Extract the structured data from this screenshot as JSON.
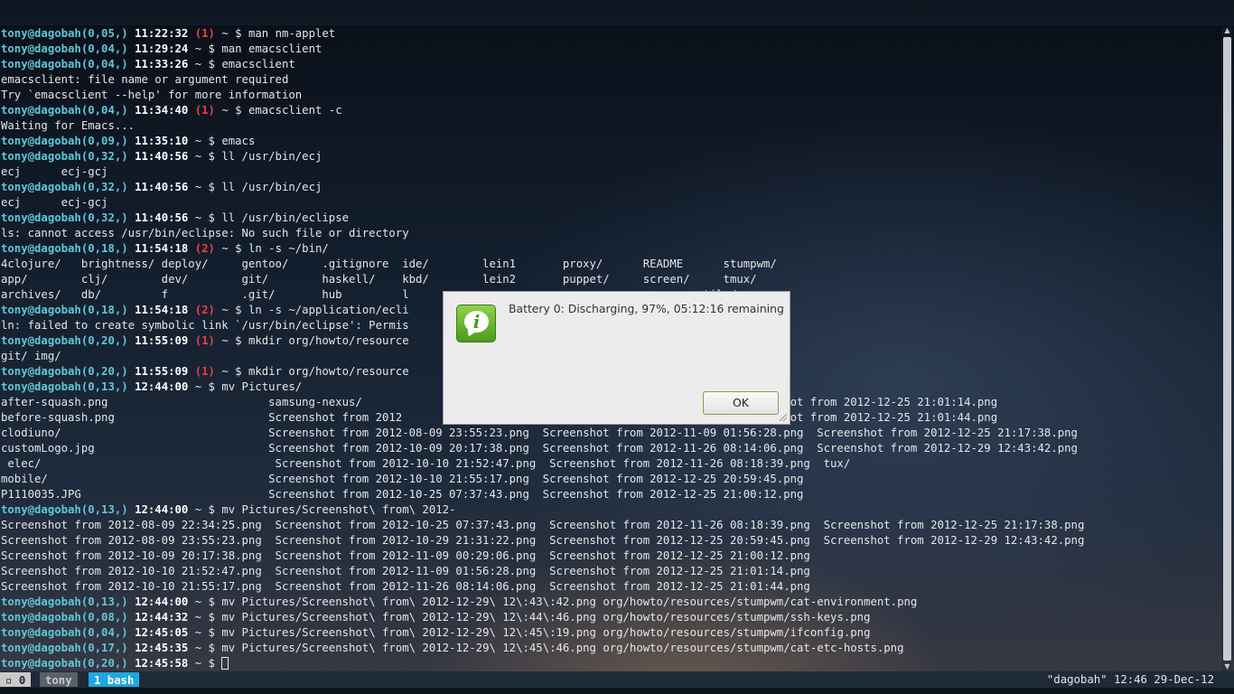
{
  "terminal": {
    "lines": [
      {
        "user": "tony@dagobah(0,05,)",
        "time": "11:22:32",
        "err": "(1)",
        "cmd": "~ $ man nm-applet"
      },
      {
        "user": "tony@dagobah(0,04,)",
        "time": "11:29:24",
        "cmd": "~ $ man emacsclient"
      },
      {
        "user": "tony@dagobah(0,04,)",
        "time": "11:33:26",
        "cmd": "~ $ emacsclient"
      },
      {
        "text": "emacsclient: file name or argument required"
      },
      {
        "text": "Try `emacsclient --help' for more information"
      },
      {
        "user": "tony@dagobah(0,04,)",
        "time": "11:34:40",
        "err": "(1)",
        "cmd": "~ $ emacsclient -c"
      },
      {
        "text": "Waiting for Emacs..."
      },
      {
        "user": "tony@dagobah(0,09,)",
        "time": "11:35:10",
        "cmd": "~ $ emacs"
      },
      {
        "user": "tony@dagobah(0,32,)",
        "time": "11:40:56",
        "cmd": "~ $ ll /usr/bin/ecj"
      },
      {
        "text": "ecj      ecj-gcj"
      },
      {
        "user": "tony@dagobah(0,32,)",
        "time": "11:40:56",
        "cmd": "~ $ ll /usr/bin/ecj"
      },
      {
        "text": "ecj      ecj-gcj"
      },
      {
        "user": "tony@dagobah(0,32,)",
        "time": "11:40:56",
        "cmd": "~ $ ll /usr/bin/eclipse"
      },
      {
        "text": "ls: cannot access /usr/bin/eclipse: No such file or directory"
      },
      {
        "user": "tony@dagobah(0,18,)",
        "time": "11:54:18",
        "err": "(2)",
        "cmd": "~ $ ln -s ~/bin/"
      },
      {
        "text": "4clojure/   brightness/ deploy/     gentoo/     .gitignore  ide/        lein1       proxy/      README      stumpwm/"
      },
      {
        "text": "app/        clj/        dev/        git/        haskell/    kbd/        lein2       puppet/     screen/     tmux/"
      },
      {
        "text": "archives/   db/         f           .git/       hub         l                                            tils/"
      },
      {
        "user": "tony@dagobah(0,18,)",
        "time": "11:54:18",
        "err": "(2)",
        "cmd": "~ $ ln -s ~/application/ecli"
      },
      {
        "text": "ln: failed to create symbolic link `/usr/bin/eclipse': Permis"
      },
      {
        "user": "tony@dagobah(0,20,)",
        "time": "11:55:09",
        "err": "(1)",
        "cmd": "~ $ mkdir org/howto/resource"
      },
      {
        "text": "git/ img/"
      },
      {
        "user": "tony@dagobah(0,20,)",
        "time": "11:55:09",
        "err": "(1)",
        "cmd": "~ $ mkdir org/howto/resource"
      },
      {
        "user": "tony@dagobah(0,13,)",
        "time": "12:44:00",
        "cmd": "~ $ mv Pictures/"
      },
      {
        "text": "after-squash.png                        samsung-nexus/                                          21:31:22.png  Screenshot from 2012-12-25 21:01:14.png"
      },
      {
        "text": "before-squash.png                       Screenshot from 2012                                    00:29:06.png  Screenshot from 2012-12-25 21:01:44.png"
      },
      {
        "text": "clodiuno/                               Screenshot from 2012-08-09 23:55:23.png  Screenshot from 2012-11-09 01:56:28.png  Screenshot from 2012-12-25 21:17:38.png"
      },
      {
        "text": "customLogo.jpg                          Screenshot from 2012-10-09 20:17:38.png  Screenshot from 2012-11-26 08:14:06.png  Screenshot from 2012-12-29 12:43:42.png"
      },
      {
        "text": " elec/                                   Screenshot from 2012-10-10 21:52:47.png  Screenshot from 2012-11-26 08:18:39.png  tux/"
      },
      {
        "text": "mobile/                                 Screenshot from 2012-10-10 21:55:17.png  Screenshot from 2012-12-25 20:59:45.png"
      },
      {
        "text": "P1110035.JPG                            Screenshot from 2012-10-25 07:37:43.png  Screenshot from 2012-12-25 21:00:12.png"
      },
      {
        "user": "tony@dagobah(0,13,)",
        "time": "12:44:00",
        "cmd": "~ $ mv Pictures/Screenshot\\ from\\ 2012-"
      },
      {
        "text": "Screenshot from 2012-08-09 22:34:25.png  Screenshot from 2012-10-25 07:37:43.png  Screenshot from 2012-11-26 08:18:39.png  Screenshot from 2012-12-25 21:17:38.png"
      },
      {
        "text": "Screenshot from 2012-08-09 23:55:23.png  Screenshot from 2012-10-29 21:31:22.png  Screenshot from 2012-12-25 20:59:45.png  Screenshot from 2012-12-29 12:43:42.png"
      },
      {
        "text": "Screenshot from 2012-10-09 20:17:38.png  Screenshot from 2012-11-09 00:29:06.png  Screenshot from 2012-12-25 21:00:12.png"
      },
      {
        "text": "Screenshot from 2012-10-10 21:52:47.png  Screenshot from 2012-11-09 01:56:28.png  Screenshot from 2012-12-25 21:01:14.png"
      },
      {
        "text": "Screenshot from 2012-10-10 21:55:17.png  Screenshot from 2012-11-26 08:14:06.png  Screenshot from 2012-12-25 21:01:44.png"
      },
      {
        "user": "tony@dagobah(0,13,)",
        "time": "12:44:00",
        "cmd": "~ $ mv Pictures/Screenshot\\ from\\ 2012-12-29\\ 12\\:43\\:42.png org/howto/resources/stumpwm/cat-environment.png"
      },
      {
        "user": "tony@dagobah(0,08,)",
        "time": "12:44:32",
        "cmd": "~ $ mv Pictures/Screenshot\\ from\\ 2012-12-29\\ 12\\:44\\:46.png org/howto/resources/stumpwm/ssh-keys.png"
      },
      {
        "user": "tony@dagobah(0,04,)",
        "time": "12:45:05",
        "cmd": "~ $ mv Pictures/Screenshot\\ from\\ 2012-12-29\\ 12\\:45\\:19.png org/howto/resources/stumpwm/ifconfig.png"
      },
      {
        "user": "tony@dagobah(0,17,)",
        "time": "12:45:35",
        "cmd": "~ $ mv Pictures/Screenshot\\ from\\ 2012-12-29\\ 12\\:45\\:46.png org/howto/resources/stumpwm/cat-etc-hosts.png"
      },
      {
        "user": "tony@dagobah(0,20,)",
        "time": "12:45:58",
        "cmd": "~ $ ",
        "cursor": true
      }
    ]
  },
  "statusbar": {
    "window_index": "0",
    "session": "tony",
    "active_window": "1 bash",
    "right_text": "\"dagobah\" 12:46 29-Dec-12"
  },
  "dialog": {
    "message": "Battery 0: Discharging, 97%, 05:12:16 remaining",
    "ok_label": "OK",
    "icon": "info-icon",
    "icon_glyph": "i"
  },
  "colors": {
    "prompt_user": "#5fc7d8",
    "error_code": "#ef3e3e",
    "active_tab": "#1ea7e0"
  }
}
